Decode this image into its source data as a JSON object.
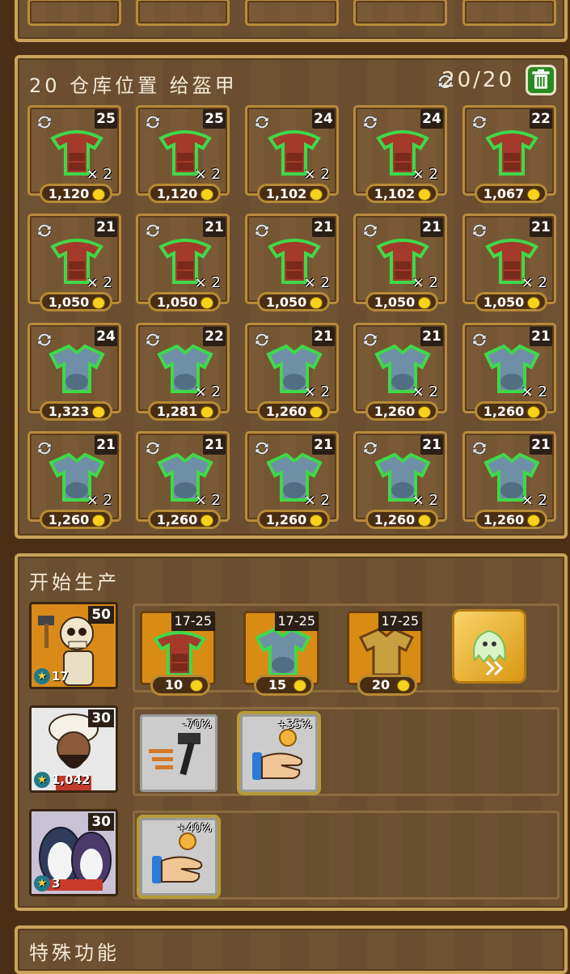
{
  "storage": {
    "title": "20 仓库位置 给盔甲",
    "count": "20/20",
    "qty_prefix": "× ",
    "rows": [
      [
        {
          "level": "25",
          "qty": "2",
          "price": "1,120",
          "type": "leather"
        },
        {
          "level": "25",
          "qty": "2",
          "price": "1,120",
          "type": "leather"
        },
        {
          "level": "24",
          "qty": "2",
          "price": "1,102",
          "type": "leather"
        },
        {
          "level": "24",
          "qty": "2",
          "price": "1,102",
          "type": "leather"
        },
        {
          "level": "22",
          "qty": "",
          "price": "1,067",
          "type": "leather"
        }
      ],
      [
        {
          "level": "21",
          "qty": "2",
          "price": "1,050",
          "type": "leather"
        },
        {
          "level": "21",
          "qty": "2",
          "price": "1,050",
          "type": "leather"
        },
        {
          "level": "21",
          "qty": "2",
          "price": "1,050",
          "type": "leather"
        },
        {
          "level": "21",
          "qty": "2",
          "price": "1,050",
          "type": "leather"
        },
        {
          "level": "21",
          "qty": "2",
          "price": "1,050",
          "type": "leather"
        }
      ],
      [
        {
          "level": "24",
          "qty": "",
          "price": "1,323",
          "type": "steel"
        },
        {
          "level": "22",
          "qty": "2",
          "price": "1,281",
          "type": "steel"
        },
        {
          "level": "21",
          "qty": "2",
          "price": "1,260",
          "type": "steel"
        },
        {
          "level": "21",
          "qty": "2",
          "price": "1,260",
          "type": "steel"
        },
        {
          "level": "21",
          "qty": "2",
          "price": "1,260",
          "type": "steel"
        }
      ],
      [
        {
          "level": "21",
          "qty": "2",
          "price": "1,260",
          "type": "steel"
        },
        {
          "level": "21",
          "qty": "2",
          "price": "1,260",
          "type": "steel"
        },
        {
          "level": "21",
          "qty": "2",
          "price": "1,260",
          "type": "steel"
        },
        {
          "level": "21",
          "qty": "2",
          "price": "1,260",
          "type": "steel"
        },
        {
          "level": "21",
          "qty": "2",
          "price": "1,260",
          "type": "steel"
        }
      ]
    ]
  },
  "production": {
    "title": "开始生产",
    "workers": [
      {
        "name": "skeleton",
        "level": "50",
        "stat": "17"
      },
      {
        "name": "merchant",
        "level": "30",
        "stat": "1,042"
      },
      {
        "name": "penguins",
        "level": "30",
        "stat": "3"
      }
    ],
    "recipes": [
      {
        "range": "17-25",
        "cost": "10",
        "type": "leather"
      },
      {
        "range": "17-25",
        "cost": "15",
        "type": "steel"
      },
      {
        "range": "17-25",
        "cost": "20",
        "type": "gold"
      }
    ],
    "boosts_row2": [
      {
        "pct": "-70%",
        "icon": "hammer-speed-icon"
      },
      {
        "pct": "+35%",
        "icon": "hand-coin-icon"
      }
    ],
    "boosts_row3": [
      {
        "pct": "+40%",
        "icon": "hand-coin-icon"
      }
    ]
  },
  "special": {
    "title": "特殊功能"
  }
}
